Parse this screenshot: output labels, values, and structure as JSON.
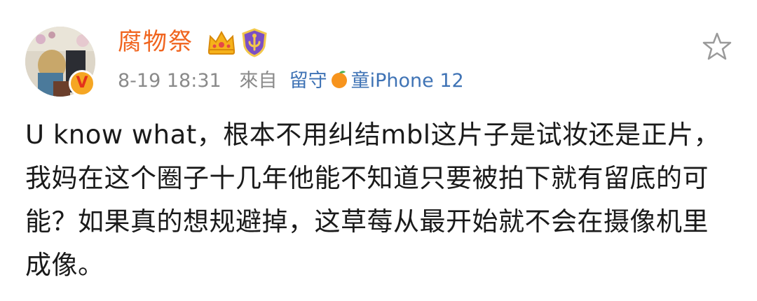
{
  "post": {
    "username": "腐物祭",
    "timestamp": "8-19 18:31",
    "from_label": "來自",
    "source_prefix": "留守",
    "source_suffix": "童iPhone 12",
    "content": "U know what，根本不用纠结mbl这片子是试妆还是正片，我妈在这个圈子十几年他能不知道只要被拍下就有留底的可能？如果真的想规避掉，这草莓从最开始就不会在摄像机里成像。"
  },
  "badges": {
    "verified_label": "V",
    "crown_icon": "crown-icon",
    "shield_icon": "shield-icon"
  },
  "actions": {
    "favorite_icon": "star-outline-icon"
  },
  "colors": {
    "username": "#f0641e",
    "meta": "#8a8a8a",
    "source_link": "#3f73b5",
    "text": "#1a1a1a"
  }
}
